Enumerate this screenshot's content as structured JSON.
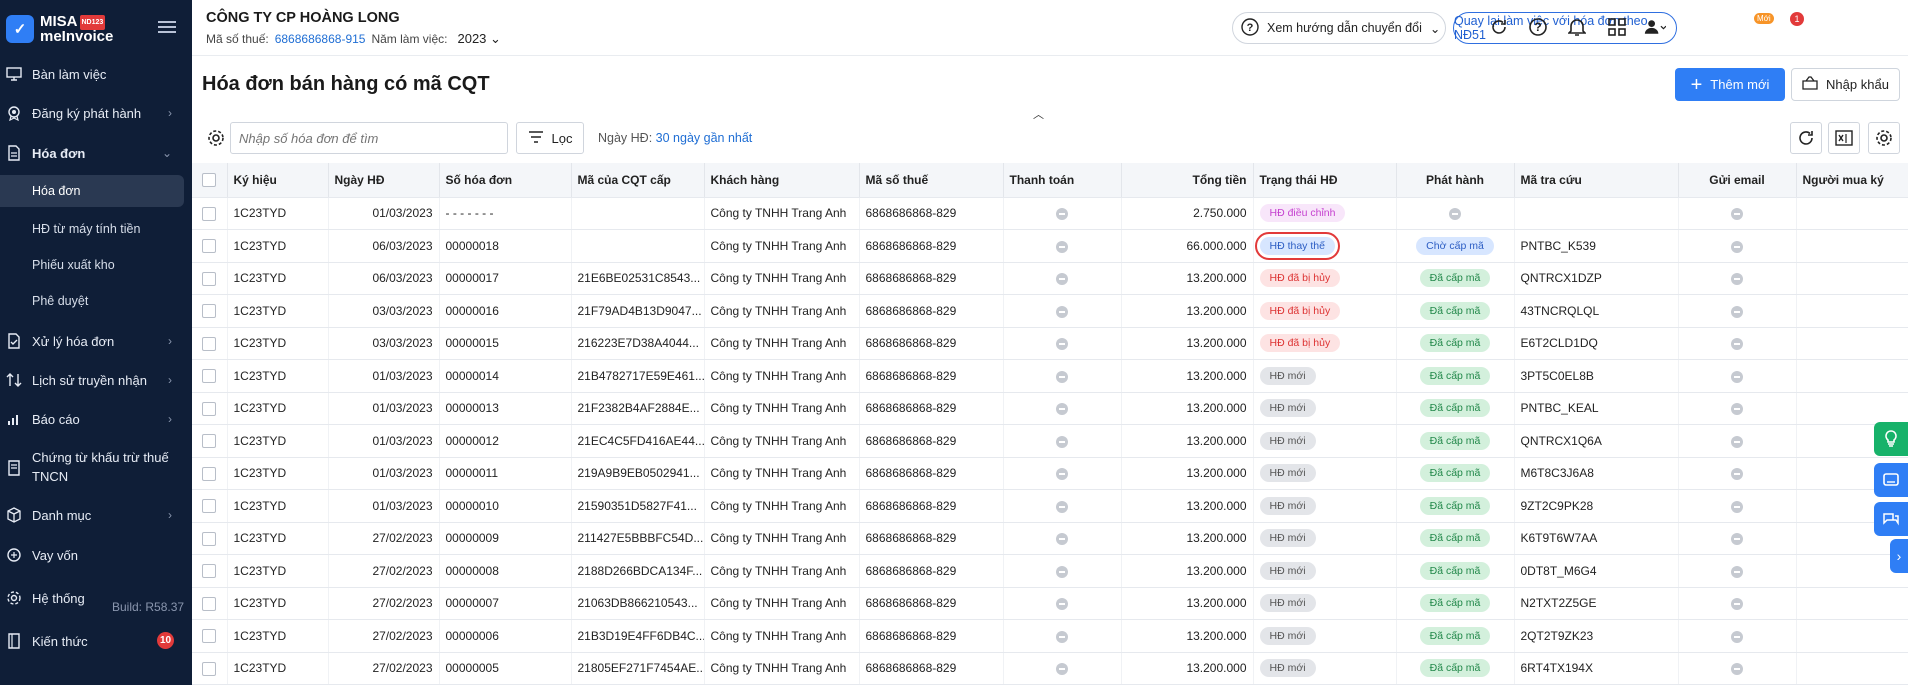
{
  "brand": {
    "name1": "MISA",
    "name2": "meInvoice",
    "tag": "ND123"
  },
  "sidebar": {
    "items": [
      {
        "label": "Bàn làm việc",
        "icon": "monitor-icon"
      },
      {
        "label": "Đăng ký phát hành",
        "icon": "badge-icon"
      },
      {
        "label": "Hóa đơn",
        "icon": "document-icon"
      },
      {
        "label": "Xử lý hóa đơn",
        "icon": "process-icon"
      },
      {
        "label": "Lịch sử truyền nhận",
        "icon": "transfer-icon"
      },
      {
        "label": "Báo cáo",
        "icon": "report-icon"
      },
      {
        "label": "Chứng từ khấu trừ thuế",
        "label2": "TNCN",
        "icon": "certificate-icon"
      },
      {
        "label": "Danh mục",
        "icon": "box-icon"
      },
      {
        "label": "Vay vốn",
        "icon": "loan-icon"
      },
      {
        "label": "Hệ thống",
        "icon": "gear-icon"
      },
      {
        "label": "Kiến thức",
        "icon": "book-icon"
      }
    ],
    "subitems": [
      "Hóa đơn",
      "HĐ từ máy tính tiền",
      "Phiếu xuất kho",
      "Phê duyệt"
    ],
    "build": "Build: R58.37",
    "knowledge_count": "10"
  },
  "header": {
    "company": "CÔNG TY CP HOÀNG LONG",
    "tax_label": "Mã số thuế:",
    "tax_value": "6868686868-915",
    "year_label": "Năm làm việc:",
    "year_value": "2023",
    "help": "Xem hướng dẫn chuyển đổi",
    "back": "Quay lại làm việc với hóa đơn theo NĐ51",
    "new_tag": "Mới",
    "notif_count": "1"
  },
  "page": {
    "title": "Hóa đơn bán hàng có mã CQT",
    "add": "Thêm mới",
    "import": "Nhập khẩu",
    "search_placeholder": "Nhập số hóa đơn để tìm",
    "filter": "Lọc",
    "date_label": "Ngày HĐ:",
    "date_value": "30 ngày gần nhất"
  },
  "table": {
    "columns": [
      "Ký hiệu",
      "Ngày HĐ",
      "Số hóa đơn",
      "Mã của CQT cấp",
      "Khách hàng",
      "Mã số thuế",
      "Thanh toán",
      "Tổng tiền",
      "Trạng thái HĐ",
      "Phát hành",
      "Mã tra cứu",
      "Gửi email",
      "Người mua ký"
    ],
    "rows": [
      {
        "kyhieu": "1C23TYD",
        "ngay": "01/03/2023",
        "so": "- - - - - - -",
        "ma": "",
        "kh": "Công ty TNHH Trang Anh",
        "mst": "6868686868-829",
        "tong": "2.750.000",
        "tt": "HĐ điều chỉnh",
        "ttc": "b-dieu",
        "ph": "",
        "phc": "dot",
        "tra": ""
      },
      {
        "kyhieu": "1C23TYD",
        "ngay": "06/03/2023",
        "so": "00000018",
        "ma": "",
        "kh": "Công ty TNHH Trang Anh",
        "mst": "6868686868-829",
        "tong": "66.000.000",
        "tt": "HĐ thay thế",
        "ttc": "b-thay",
        "ph": "Chờ cấp mã",
        "phc": "b-cho",
        "tra": "PNTBC_K539",
        "hl": true
      },
      {
        "kyhieu": "1C23TYD",
        "ngay": "06/03/2023",
        "so": "00000017",
        "ma": "21E6BE02531C8543...",
        "kh": "Công ty TNHH Trang Anh",
        "mst": "6868686868-829",
        "tong": "13.200.000",
        "tt": "HĐ đã bị hủy",
        "ttc": "b-huy",
        "ph": "Đã cấp mã",
        "phc": "b-da",
        "tra": "QNTRCX1DZP"
      },
      {
        "kyhieu": "1C23TYD",
        "ngay": "03/03/2023",
        "so": "00000016",
        "ma": "21F79AD4B13D9047...",
        "kh": "Công ty TNHH Trang Anh",
        "mst": "6868686868-829",
        "tong": "13.200.000",
        "tt": "HĐ đã bị hủy",
        "ttc": "b-huy",
        "ph": "Đã cấp mã",
        "phc": "b-da",
        "tra": "43TNCRQLQL"
      },
      {
        "kyhieu": "1C23TYD",
        "ngay": "03/03/2023",
        "so": "00000015",
        "ma": "216223E7D38A4044...",
        "kh": "Công ty TNHH Trang Anh",
        "mst": "6868686868-829",
        "tong": "13.200.000",
        "tt": "HĐ đã bị hủy",
        "ttc": "b-huy",
        "ph": "Đã cấp mã",
        "phc": "b-da",
        "tra": "E6T2CLD1DQ"
      },
      {
        "kyhieu": "1C23TYD",
        "ngay": "01/03/2023",
        "so": "00000014",
        "ma": "21B4782717E59E461...",
        "kh": "Công ty TNHH Trang Anh",
        "mst": "6868686868-829",
        "tong": "13.200.000",
        "tt": "HĐ mới",
        "ttc": "b-moi",
        "ph": "Đã cấp mã",
        "phc": "b-da",
        "tra": "3PT5C0EL8B"
      },
      {
        "kyhieu": "1C23TYD",
        "ngay": "01/03/2023",
        "so": "00000013",
        "ma": "21F2382B4AF2884E...",
        "kh": "Công ty TNHH Trang Anh",
        "mst": "6868686868-829",
        "tong": "13.200.000",
        "tt": "HĐ mới",
        "ttc": "b-moi",
        "ph": "Đã cấp mã",
        "phc": "b-da",
        "tra": "PNTBC_KEAL"
      },
      {
        "kyhieu": "1C23TYD",
        "ngay": "01/03/2023",
        "so": "00000012",
        "ma": "21EC4C5FD416AE44...",
        "kh": "Công ty TNHH Trang Anh",
        "mst": "6868686868-829",
        "tong": "13.200.000",
        "tt": "HĐ mới",
        "ttc": "b-moi",
        "ph": "Đã cấp mã",
        "phc": "b-da",
        "tra": "QNTRCX1Q6A"
      },
      {
        "kyhieu": "1C23TYD",
        "ngay": "01/03/2023",
        "so": "00000011",
        "ma": "219A9B9EB0502941...",
        "kh": "Công ty TNHH Trang Anh",
        "mst": "6868686868-829",
        "tong": "13.200.000",
        "tt": "HĐ mới",
        "ttc": "b-moi",
        "ph": "Đã cấp mã",
        "phc": "b-da",
        "tra": "M6T8C3J6A8"
      },
      {
        "kyhieu": "1C23TYD",
        "ngay": "01/03/2023",
        "so": "00000010",
        "ma": "21590351D5827F41...",
        "kh": "Công ty TNHH Trang Anh",
        "mst": "6868686868-829",
        "tong": "13.200.000",
        "tt": "HĐ mới",
        "ttc": "b-moi",
        "ph": "Đã cấp mã",
        "phc": "b-da",
        "tra": "9ZT2C9PK28"
      },
      {
        "kyhieu": "1C23TYD",
        "ngay": "27/02/2023",
        "so": "00000009",
        "ma": "211427E5BBBFC54D...",
        "kh": "Công ty TNHH Trang Anh",
        "mst": "6868686868-829",
        "tong": "13.200.000",
        "tt": "HĐ mới",
        "ttc": "b-moi",
        "ph": "Đã cấp mã",
        "phc": "b-da",
        "tra": "K6T9T6W7AA"
      },
      {
        "kyhieu": "1C23TYD",
        "ngay": "27/02/2023",
        "so": "00000008",
        "ma": "2188D266BDCA134F...",
        "kh": "Công ty TNHH Trang Anh",
        "mst": "6868686868-829",
        "tong": "13.200.000",
        "tt": "HĐ mới",
        "ttc": "b-moi",
        "ph": "Đã cấp mã",
        "phc": "b-da",
        "tra": "0DT8T_M6G4"
      },
      {
        "kyhieu": "1C23TYD",
        "ngay": "27/02/2023",
        "so": "00000007",
        "ma": "21063DB866210543...",
        "kh": "Công ty TNHH Trang Anh",
        "mst": "6868686868-829",
        "tong": "13.200.000",
        "tt": "HĐ mới",
        "ttc": "b-moi",
        "ph": "Đã cấp mã",
        "phc": "b-da",
        "tra": "N2TXT2Z5GE"
      },
      {
        "kyhieu": "1C23TYD",
        "ngay": "27/02/2023",
        "so": "00000006",
        "ma": "21B3D19E4FF6DB4C...",
        "kh": "Công ty TNHH Trang Anh",
        "mst": "6868686868-829",
        "tong": "13.200.000",
        "tt": "HĐ mới",
        "ttc": "b-moi",
        "ph": "Đã cấp mã",
        "phc": "b-da",
        "tra": "2QT2T9ZK23"
      },
      {
        "kyhieu": "1C23TYD",
        "ngay": "27/02/2023",
        "so": "00000005",
        "ma": "21805EF271F7454AE...",
        "kh": "Công ty TNHH Trang Anh",
        "mst": "6868686868-829",
        "tong": "13.200.000",
        "tt": "HĐ mới",
        "ttc": "b-moi",
        "ph": "Đã cấp mã",
        "phc": "b-da",
        "tra": "6RT4TX194X"
      }
    ]
  }
}
